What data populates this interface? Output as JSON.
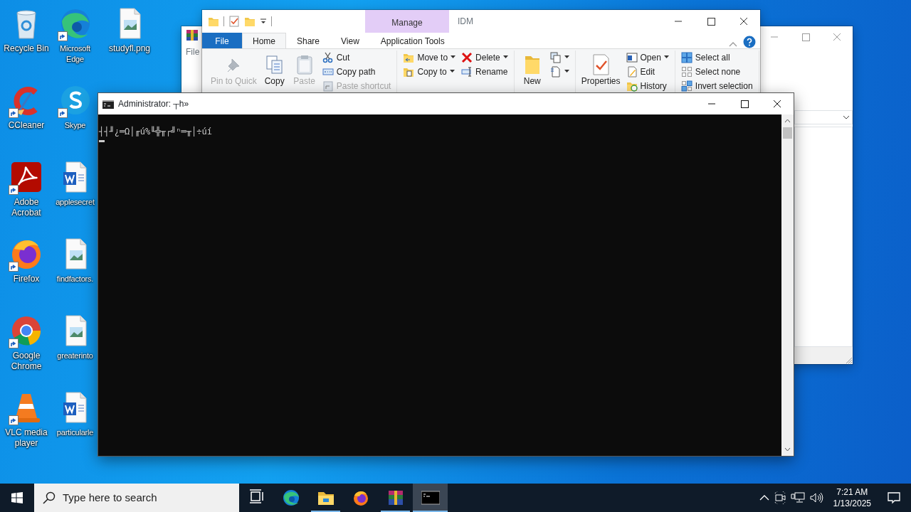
{
  "desktop_icons": [
    {
      "label": "Recycle Bin",
      "shortcut": false
    },
    {
      "label": "CCleaner",
      "shortcut": true
    },
    {
      "label": "Adobe Acrobat",
      "shortcut": true
    },
    {
      "label": "Firefox",
      "shortcut": true
    },
    {
      "label": "Google Chrome",
      "shortcut": true
    },
    {
      "label": "VLC media player",
      "shortcut": true
    },
    {
      "label": "Microsoft Edge",
      "shortcut": true
    },
    {
      "label": "Skype",
      "shortcut": true
    },
    {
      "label": "applesecret",
      "shortcut": false
    },
    {
      "label": "findfactors.",
      "shortcut": false
    },
    {
      "label": "greaterinto",
      "shortcut": false
    },
    {
      "label": "particularle",
      "shortcut": false
    },
    {
      "label": "studyfl.png",
      "shortcut": false
    }
  ],
  "background_window": {
    "menu": "File"
  },
  "explorer": {
    "context_header": "Manage",
    "title": "IDM",
    "tabs": [
      {
        "label": "File",
        "kind": "file",
        "selected": false
      },
      {
        "label": "Home",
        "kind": "tab",
        "selected": true
      },
      {
        "label": "Share",
        "kind": "tab",
        "selected": false
      },
      {
        "label": "View",
        "kind": "tab",
        "selected": false
      },
      {
        "label": "Application Tools",
        "kind": "tab",
        "selected": false
      }
    ],
    "ribbon": [
      [
        {
          "kind": "large",
          "label": "Pin to Quick",
          "disabled": true
        },
        {
          "kind": "large",
          "label": "Copy",
          "disabled": false
        },
        {
          "kind": "large",
          "label": "Paste",
          "disabled": true
        },
        {
          "kind": "stack",
          "items": [
            {
              "label": "Cut",
              "dropdown": false,
              "disabled": false
            },
            {
              "label": "Copy path",
              "dropdown": false,
              "disabled": false
            },
            {
              "label": "Paste shortcut",
              "dropdown": false,
              "disabled": true
            }
          ]
        }
      ],
      [
        {
          "kind": "stack",
          "items": [
            {
              "label": "Move to",
              "dropdown": true,
              "disabled": false
            },
            {
              "label": "Copy to",
              "dropdown": true,
              "disabled": false
            }
          ]
        },
        {
          "kind": "stack",
          "items": [
            {
              "label": "Delete",
              "dropdown": true,
              "disabled": false
            },
            {
              "label": "Rename",
              "dropdown": false,
              "disabled": false
            }
          ]
        }
      ],
      [
        {
          "kind": "large",
          "label": "New",
          "disabled": false
        },
        {
          "kind": "stack",
          "items": [
            {
              "dropdown": true,
              "disabled": false
            },
            {
              "dropdown": true,
              "disabled": false
            }
          ]
        }
      ],
      [
        {
          "kind": "large",
          "label": "Properties",
          "disabled": false
        },
        {
          "kind": "stack",
          "items": [
            {
              "label": "Open",
              "dropdown": true,
              "disabled": false
            },
            {
              "label": "Edit",
              "dropdown": false,
              "disabled": false
            },
            {
              "label": "History",
              "dropdown": false,
              "disabled": false
            }
          ]
        }
      ],
      [
        {
          "kind": "stack",
          "items": [
            {
              "label": "Select all",
              "dropdown": false,
              "disabled": false
            },
            {
              "label": "Select none",
              "dropdown": false,
              "disabled": false
            },
            {
              "label": "Invert selection",
              "dropdown": false,
              "disabled": false
            }
          ]
        }
      ]
    ]
  },
  "console": {
    "title": "Administrator: ┬h»",
    "lines": [
      "┤┤╜¿═Ω│╓ú%╙╬╥┌╝ⁿ═╥│÷úí"
    ],
    "cursor": true
  },
  "taskbar": {
    "search_placeholder": "Type here to search",
    "apps": [
      {
        "running": false,
        "active": false
      },
      {
        "running": false,
        "active": false
      },
      {
        "running": true,
        "active": false
      },
      {
        "running": false,
        "active": false
      },
      {
        "running": true,
        "active": false
      },
      {
        "running": true,
        "active": true
      }
    ],
    "time": "7:21 AM",
    "date": "1/13/2025"
  }
}
